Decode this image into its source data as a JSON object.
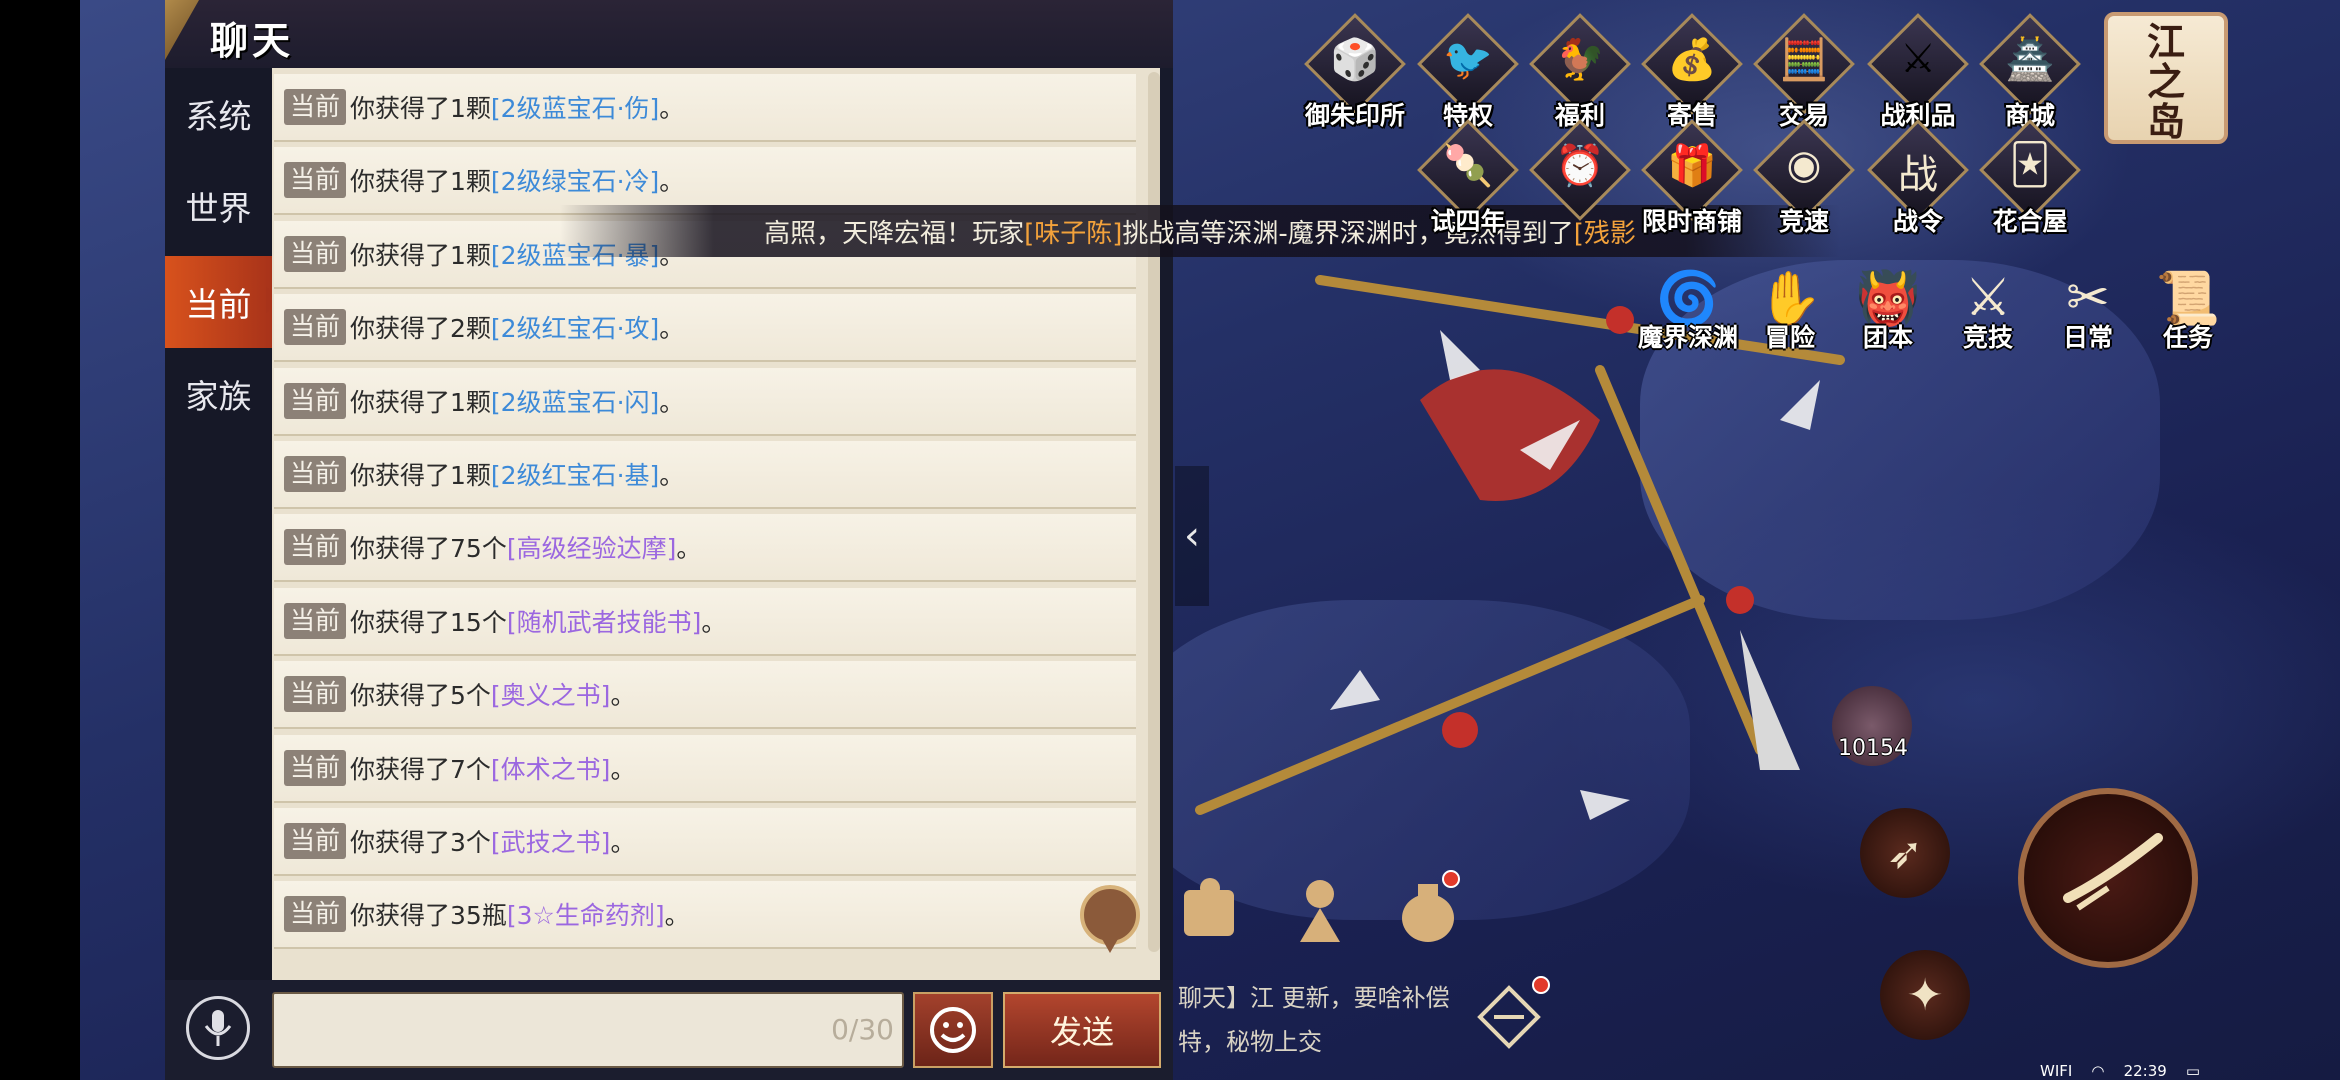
{
  "chat": {
    "title": "聊天",
    "tabs": [
      {
        "label": "系统"
      },
      {
        "label": "世界"
      },
      {
        "label": "当前"
      },
      {
        "label": "家族"
      }
    ],
    "badge": "当前",
    "messages": [
      {
        "prefix": "你获得了1颗",
        "item": "[2级蓝宝石·伤]",
        "suffix": "。",
        "color": "#3d8ad8"
      },
      {
        "prefix": "你获得了1颗",
        "item": "[2级绿宝石·冷]",
        "suffix": "。",
        "color": "#3d8ad8"
      },
      {
        "prefix": "你获得了1颗",
        "item": "[2级蓝宝石·暴]",
        "suffix": "。",
        "color": "#3d8ad8"
      },
      {
        "prefix": "你获得了2颗",
        "item": "[2级红宝石·攻]",
        "suffix": "。",
        "color": "#3d8ad8"
      },
      {
        "prefix": "你获得了1颗",
        "item": "[2级蓝宝石·闪]",
        "suffix": "。",
        "color": "#3d8ad8"
      },
      {
        "prefix": "你获得了1颗",
        "item": "[2级红宝石·基]",
        "suffix": "。",
        "color": "#3d8ad8"
      },
      {
        "prefix": "你获得了75个",
        "item": "[高级经验达摩]",
        "suffix": "。",
        "color": "#9b67e0"
      },
      {
        "prefix": "你获得了15个",
        "item": "[随机武者技能书]",
        "suffix": "。",
        "color": "#9b67e0"
      },
      {
        "prefix": "你获得了5个",
        "item": "[奥义之书]",
        "suffix": "。",
        "color": "#9b67e0"
      },
      {
        "prefix": "你获得了7个",
        "item": "[体术之书]",
        "suffix": "。",
        "color": "#9b67e0"
      },
      {
        "prefix": "你获得了3个",
        "item": "[武技之书]",
        "suffix": "。",
        "color": "#9b67e0"
      },
      {
        "prefix": "你获得了35瓶",
        "item": "[3☆生命药剂]",
        "suffix": "。",
        "color": "#9b67e0"
      }
    ],
    "input_counter": "0/30",
    "send_label": "发送"
  },
  "broadcast": {
    "pre": "高照，天降宏福！玩家",
    "player": "[味子陈]",
    "mid": "挑战高等深渊-魔界深渊时，竟然得到了",
    "item": "[残影"
  },
  "top_icons_row1": [
    "御朱印所",
    "特权",
    "福利",
    "寄售",
    "交易",
    "战利品",
    "商城"
  ],
  "top_icons_row2": [
    "试四年",
    "",
    "限时商铺",
    "竞速",
    "战令",
    "花合屋"
  ],
  "island_label": "江之岛",
  "mode_buttons": [
    "魔界深渊",
    "冒险",
    "团本",
    "竞技",
    "日常",
    "任务"
  ],
  "potion_count": "10154",
  "bottom_chat": {
    "line1": "聊天】江 更新，要啥补偿",
    "line2": "特，秘物上交"
  },
  "status_bar": {
    "wifi": "WIFI",
    "time": "22:39"
  },
  "colors": {
    "accent_orange": "#d8521c",
    "item_blue": "#3d8ad8",
    "item_purple": "#9b67e0",
    "player_orange": "#f3a23b"
  }
}
